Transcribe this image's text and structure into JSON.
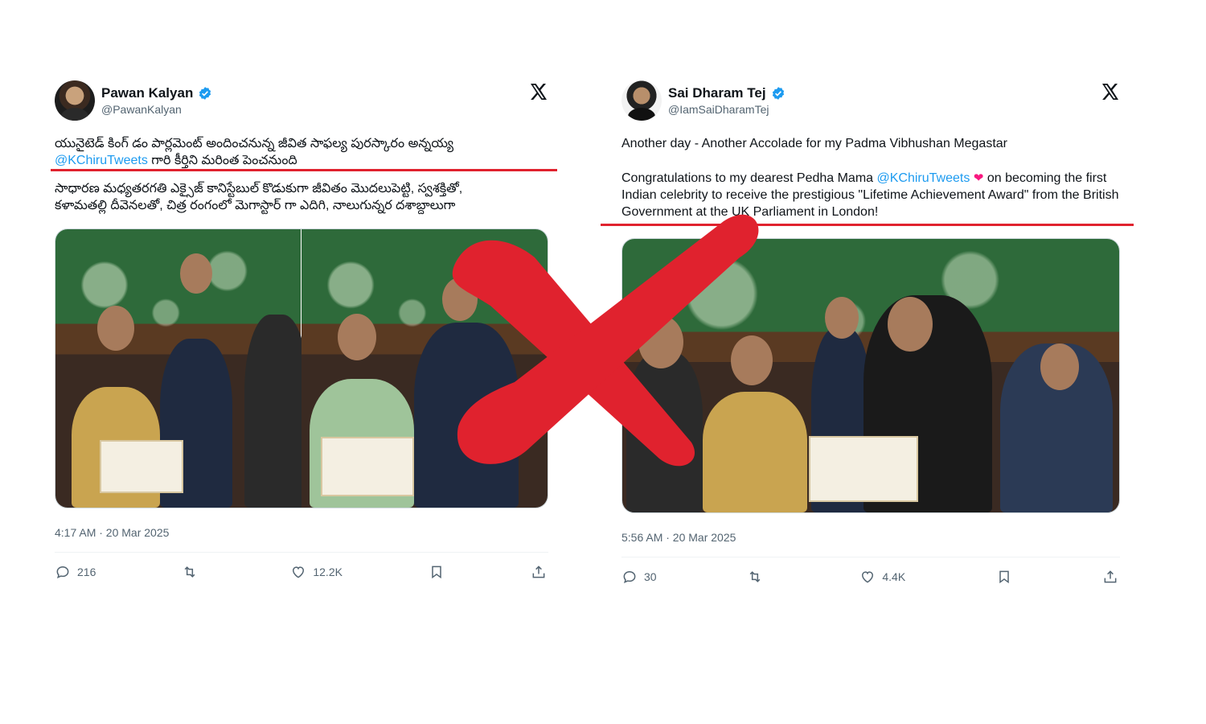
{
  "colors": {
    "accent": "#1d9bf0",
    "mark": "#e0222e",
    "verified": "#1d9bf0"
  },
  "tweet_left": {
    "name": "Pawan Kalyan",
    "handle": "@PawanKalyan",
    "text_line1": "యునైటెడ్ కింగ్ డం పార్లమెంట్ అందించనున్న జీవిత సాఫల్య పురస్కారం అన్నయ్య",
    "mention": "@KChiruTweets",
    "text_line2_rest": " గారి కీర్తిని మరింత పెంచనుంది",
    "text_para2": "సాధారణ మధ్యతరగతి ఎక్సైజ్ కానిస్టేబుల్ కొడుకుగా జీవితం మొదలుపెట్టి, స్వశక్తితో,\nకళామతల్లి దీవెనలతో, చిత్ర రంగంలో మెగాస్టార్ గా ఎదిగి, నాలుగున్నర దశాబ్దాలుగా",
    "timestamp": "4:17 AM · 20 Mar 2025",
    "replies": "216",
    "reposts": "",
    "likes": "12.2K"
  },
  "tweet_right": {
    "name": "Sai Dharam Tej",
    "handle": "@IamSaiDharamTej",
    "text_line1": "Another day - Another Accolade for my Padma Vibhushan Megastar",
    "text_p2_start": "Congratulations to my dearest Pedha Mama ",
    "mention": "@KChiruTweets",
    "heart": "❤",
    "text_p2_end": " on becoming the first Indian celebrity to receive the prestigious \"Lifetime Achievement Award\" from the British Government at the UK Parliament in London!",
    "timestamp": "5:56 AM · 20 Mar 2025",
    "replies": "30",
    "reposts": "",
    "likes": "4.4K"
  },
  "icons": [
    "verified-badge-icon",
    "x-logo-icon",
    "reply-icon",
    "repost-icon",
    "like-icon",
    "bookmark-icon",
    "share-icon"
  ]
}
